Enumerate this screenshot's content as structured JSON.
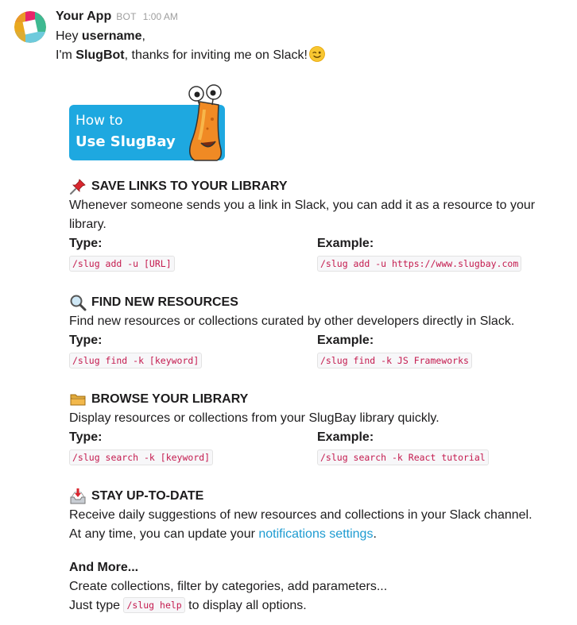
{
  "app": {
    "name": "Your App",
    "badge": "BOT",
    "time": "1:00 AM"
  },
  "greeting": {
    "hey": "Hey ",
    "username": "username",
    "comma": ",",
    "im": "I'm ",
    "bot_name": "SlugBot",
    "thanks": ", thanks for inviting me on Slack!"
  },
  "banner": {
    "line1": "How to",
    "line2": "Use SlugBay"
  },
  "labels": {
    "type": "Type:",
    "example": "Example:"
  },
  "sections": [
    {
      "icon": "pushpin-icon",
      "title": "SAVE LINKS TO YOUR LIBRARY",
      "desc": "Whenever someone sends you a link in Slack, you can add it as a resource to your library.",
      "type_code": "/slug add -u [URL]",
      "example_code": "/slug add -u https://www.slugbay.com"
    },
    {
      "icon": "magnifier-icon",
      "title": "FIND NEW RESOURCES",
      "desc": "Find new resources or collections curated by other developers directly in Slack.",
      "type_code": "/slug find -k [keyword]",
      "example_code": "/slug find -k JS Frameworks"
    },
    {
      "icon": "folder-icon",
      "title": "BROWSE YOUR LIBRARY",
      "desc": "Display resources or collections from your SlugBay library quickly.",
      "type_code": "/slug search -k [keyword]",
      "example_code": "/slug search -k React tutorial"
    }
  ],
  "stay": {
    "icon": "inbox-tray-icon",
    "title": "STAY UP-TO-DATE",
    "desc": "Receive daily suggestions of new resources and collections in your Slack channel.",
    "line2_prefix": "At any time, you can update your ",
    "link": "notifications settings",
    "line2_suffix": "."
  },
  "more": {
    "title": "And More...",
    "line1": "Create collections, filter by categories, add parameters...",
    "line2_prefix": "Just type ",
    "code": "/slug help",
    "line2_suffix": " to display all options."
  },
  "colors": {
    "banner": "#1ea8e0",
    "code_text": "#c41a4e",
    "link": "#1d9bd1"
  }
}
